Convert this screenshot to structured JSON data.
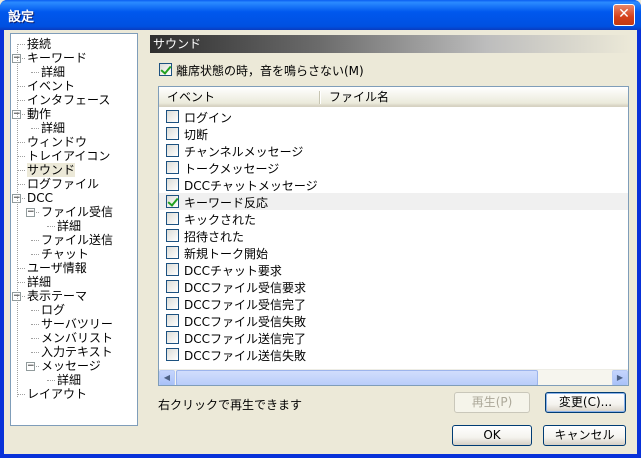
{
  "window": {
    "title": "設定",
    "close_glyph": "✕"
  },
  "tree": {
    "items": [
      {
        "label": "接続",
        "level": 1,
        "expander": null
      },
      {
        "label": "キーワード",
        "level": 1,
        "expander": "−"
      },
      {
        "label": "詳細",
        "level": 2,
        "expander": null
      },
      {
        "label": "イベント",
        "level": 1,
        "expander": null
      },
      {
        "label": "インタフェース",
        "level": 1,
        "expander": null
      },
      {
        "label": "動作",
        "level": 1,
        "expander": "−"
      },
      {
        "label": "詳細",
        "level": 2,
        "expander": null
      },
      {
        "label": "ウィンドウ",
        "level": 1,
        "expander": null
      },
      {
        "label": "トレイアイコン",
        "level": 1,
        "expander": null
      },
      {
        "label": "サウンド",
        "level": 1,
        "expander": null,
        "selected": true
      },
      {
        "label": "ログファイル",
        "level": 1,
        "expander": null
      },
      {
        "label": "DCC",
        "level": 1,
        "expander": "−"
      },
      {
        "label": "ファイル受信",
        "level": 2,
        "expander": "−"
      },
      {
        "label": "詳細",
        "level": 3,
        "expander": null
      },
      {
        "label": "ファイル送信",
        "level": 2,
        "expander": null
      },
      {
        "label": "チャット",
        "level": 2,
        "expander": null
      },
      {
        "label": "ユーザ情報",
        "level": 1,
        "expander": null
      },
      {
        "label": "詳細",
        "level": 1,
        "expander": null
      },
      {
        "label": "表示テーマ",
        "level": 1,
        "expander": "−"
      },
      {
        "label": "ログ",
        "level": 2,
        "expander": null
      },
      {
        "label": "サーバツリー",
        "level": 2,
        "expander": null
      },
      {
        "label": "メンバリスト",
        "level": 2,
        "expander": null
      },
      {
        "label": "入力テキスト",
        "level": 2,
        "expander": null
      },
      {
        "label": "メッセージ",
        "level": 2,
        "expander": "−"
      },
      {
        "label": "詳細",
        "level": 3,
        "expander": null
      },
      {
        "label": "レイアウト",
        "level": 1,
        "expander": null
      }
    ]
  },
  "section": {
    "title": "サウンド"
  },
  "option": {
    "label": "離席状態の時，音を鳴らさない(M)",
    "checked": true
  },
  "list": {
    "columns": [
      "イベント",
      "ファイル名"
    ],
    "rows": [
      {
        "label": "ログイン",
        "checked": false
      },
      {
        "label": "切断",
        "checked": false
      },
      {
        "label": "チャンネルメッセージ",
        "checked": false
      },
      {
        "label": "トークメッセージ",
        "checked": false
      },
      {
        "label": "DCCチャットメッセージ",
        "checked": false
      },
      {
        "label": "キーワード反応",
        "checked": true,
        "highlighted": true
      },
      {
        "label": "キックされた",
        "checked": false
      },
      {
        "label": "招待された",
        "checked": false
      },
      {
        "label": "新規トーク開始",
        "checked": false
      },
      {
        "label": "DCCチャット要求",
        "checked": false
      },
      {
        "label": "DCCファイル受信要求",
        "checked": false
      },
      {
        "label": "DCCファイル受信完了",
        "checked": false
      },
      {
        "label": "DCCファイル受信失敗",
        "checked": false
      },
      {
        "label": "DCCファイル送信完了",
        "checked": false
      },
      {
        "label": "DCCファイル送信失敗",
        "checked": false
      }
    ],
    "scroll_left": "◀",
    "scroll_right": "▶"
  },
  "hint": "右クリックで再生できます",
  "buttons": {
    "play": "再生(P)",
    "change": "変更(C)...",
    "ok": "OK",
    "cancel": "キャンセル"
  }
}
